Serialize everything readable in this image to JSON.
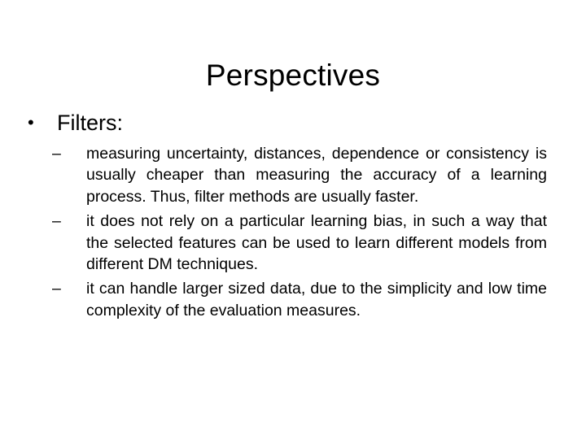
{
  "slide": {
    "title": "Perspectives",
    "bullet": {
      "marker": "•",
      "text": "Filters:"
    },
    "subbullets": [
      {
        "marker": "–",
        "text": "measuring uncertainty, distances, dependence or consistency is usually cheaper than measuring the accuracy of a learning process. Thus, filter methods are usually faster."
      },
      {
        "marker": "–",
        "text": "it does not rely on a particular learning bias, in such a way that the selected features can be used to learn different models from different DM techniques."
      },
      {
        "marker": "–",
        "text": "it can handle larger sized data, due to the  simplicity and low time complexity of the evaluation measures."
      }
    ]
  }
}
